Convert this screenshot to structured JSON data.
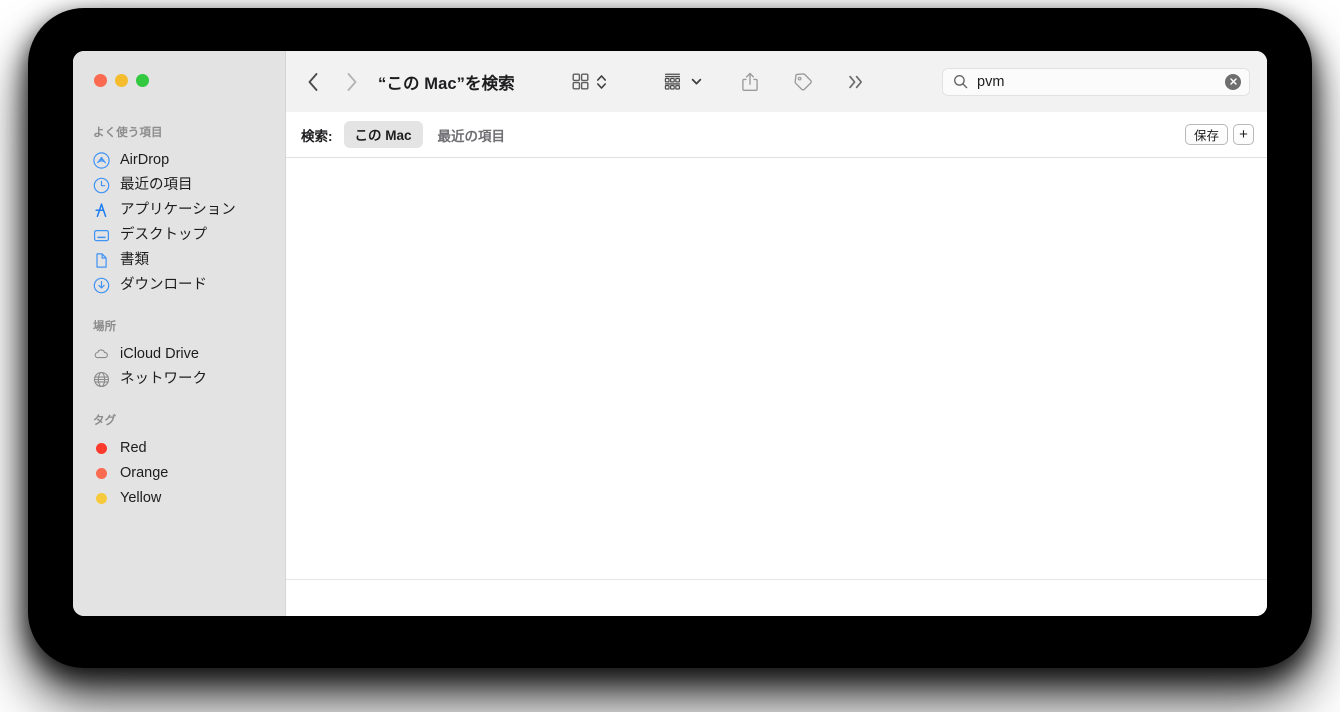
{
  "window": {
    "traffic_lights": [
      {
        "name": "close",
        "color": "#f96a50"
      },
      {
        "name": "minimize",
        "color": "#f5bd2e"
      },
      {
        "name": "maximize",
        "color": "#32c840"
      }
    ]
  },
  "toolbar": {
    "back_icon": "chevron-left-icon",
    "forward_icon": "chevron-right-icon",
    "title": "“この Mac”を検索",
    "view_mode_icon": "icon-view-grid-icon",
    "view_mode_stepper_icon": "chevron-up-down-icon",
    "group_by_icon": "group-by-icon",
    "group_by_chevron_icon": "chevron-down-icon",
    "share_icon": "share-icon",
    "tags_icon": "tag-icon",
    "more_icon": "double-chevron-right-icon"
  },
  "search": {
    "icon": "search-icon",
    "value": "pvm",
    "placeholder": "検索",
    "clear_icon": "clear-circle-icon"
  },
  "scopebar": {
    "label": "検索:",
    "scopes": [
      {
        "label": "この Mac",
        "selected": true
      },
      {
        "label": "最近の項目",
        "selected": false
      }
    ],
    "save_label": "保存",
    "add_label": "+"
  },
  "sidebar": {
    "groups": [
      {
        "title": "よく使う項目",
        "items": [
          {
            "label": "AirDrop",
            "icon": "airdrop-icon"
          },
          {
            "label": "最近の項目",
            "icon": "clock-icon"
          },
          {
            "label": "アプリケーション",
            "icon": "applications-icon"
          },
          {
            "label": "デスクトップ",
            "icon": "desktop-icon"
          },
          {
            "label": "書類",
            "icon": "document-icon"
          },
          {
            "label": "ダウンロード",
            "icon": "downloads-icon"
          }
        ]
      },
      {
        "title": "場所",
        "items": [
          {
            "label": "iCloud Drive",
            "icon": "cloud-icon"
          },
          {
            "label": "ネットワーク",
            "icon": "globe-icon"
          }
        ]
      },
      {
        "title": "タグ",
        "items": [
          {
            "label": "Red",
            "icon": "tag-dot-icon",
            "color": "#fc3b2d"
          },
          {
            "label": "Orange",
            "icon": "tag-dot-icon",
            "color": "#f96a50"
          },
          {
            "label": "Yellow",
            "icon": "tag-dot-icon",
            "color": "#f7ca3d"
          }
        ]
      }
    ]
  },
  "colors": {
    "sidebar_bg": "#e3e3e3",
    "toolbar_bg": "#f2f2f2",
    "accent_blue": "#0a7cff",
    "content_bg": "#ffffff",
    "frame": "#000000"
  },
  "results": {
    "empty": true,
    "items": []
  }
}
